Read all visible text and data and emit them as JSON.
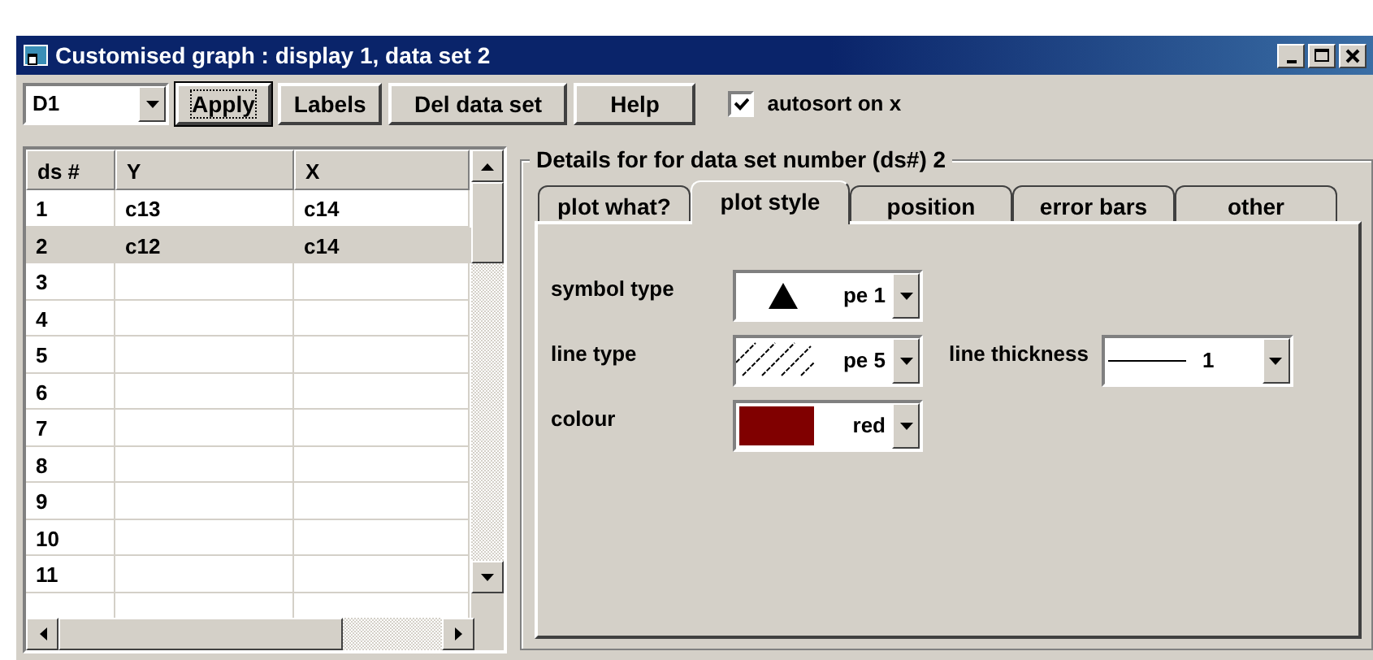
{
  "window": {
    "title": "Customised graph : display 1, data set 2"
  },
  "toolbar": {
    "display_select": {
      "value": "D1"
    },
    "buttons": [
      {
        "label": "Apply",
        "focused": true
      },
      {
        "label": "Labels",
        "focused": false
      },
      {
        "label": "Del data set",
        "focused": false
      },
      {
        "label": "Help",
        "focused": false
      }
    ],
    "autosort": {
      "label": "autosort on x",
      "checked": true
    }
  },
  "table": {
    "columns": [
      "ds #",
      "Y",
      "X"
    ],
    "rows": [
      {
        "cells": [
          "1",
          "c13",
          "c14"
        ],
        "selected": false
      },
      {
        "cells": [
          "2",
          "c12",
          "c14"
        ],
        "selected": true
      },
      {
        "cells": [
          "3",
          "",
          ""
        ],
        "selected": false
      },
      {
        "cells": [
          "4",
          "",
          ""
        ],
        "selected": false
      },
      {
        "cells": [
          "5",
          "",
          ""
        ],
        "selected": false
      },
      {
        "cells": [
          "6",
          "",
          ""
        ],
        "selected": false
      },
      {
        "cells": [
          "7",
          "",
          ""
        ],
        "selected": false
      },
      {
        "cells": [
          "8",
          "",
          ""
        ],
        "selected": false
      },
      {
        "cells": [
          "9",
          "",
          ""
        ],
        "selected": false
      },
      {
        "cells": [
          "10",
          "",
          ""
        ],
        "selected": false
      },
      {
        "cells": [
          "11",
          "",
          ""
        ],
        "selected": false
      }
    ]
  },
  "details": {
    "title": "Details for for data set number (ds#) 2",
    "tabs": [
      {
        "label": "plot what?",
        "selected": false
      },
      {
        "label": "plot style",
        "selected": true
      },
      {
        "label": "position",
        "selected": false
      },
      {
        "label": "error bars",
        "selected": false
      },
      {
        "label": "other",
        "selected": false
      }
    ],
    "symbol_type": {
      "label": "symbol type",
      "value": "pe 1"
    },
    "line_type": {
      "label": "line type",
      "value": "pe 5"
    },
    "line_thickness": {
      "label": "line thickness",
      "value": "1"
    },
    "colour": {
      "label": "colour",
      "value": "red",
      "color": "#800000"
    }
  }
}
